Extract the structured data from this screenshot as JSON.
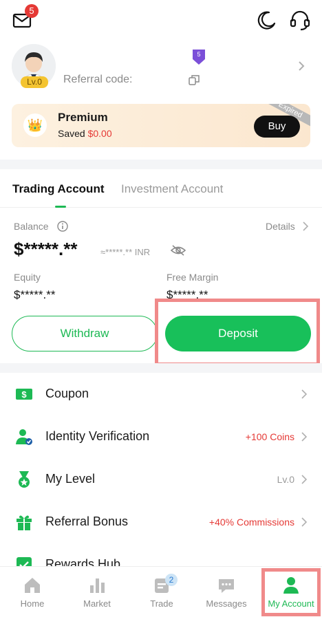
{
  "header": {
    "mail_badge_count": "5",
    "mail_icon": "mail-icon",
    "theme_icon": "moon-icon",
    "support_icon": "headset-icon"
  },
  "profile": {
    "level_badge": "Lv.0",
    "vip_badge_number": "5",
    "referral_label": "Referral code:"
  },
  "premium": {
    "title": "Premium",
    "saved_prefix": "Saved ",
    "saved_amount": "$0.00",
    "buy_label": "Buy",
    "ribbon": "Expired"
  },
  "account_tabs": {
    "active": "Trading Account",
    "inactive": "Investment Account"
  },
  "balance": {
    "label": "Balance",
    "details": "Details",
    "value": "$*****.**",
    "inr_value": "≈*****.** INR",
    "equity_label": "Equity",
    "equity_value": "$*****.**",
    "free_margin_label": "Free Margin",
    "free_margin_value": "$*****.**"
  },
  "actions": {
    "withdraw": "Withdraw",
    "deposit": "Deposit"
  },
  "menu": {
    "items": [
      {
        "label": "Coupon",
        "extra": ""
      },
      {
        "label": "Identity Verification",
        "extra": "+100 Coins"
      },
      {
        "label": "My Level",
        "extra": "Lv.0"
      },
      {
        "label": "Referral Bonus",
        "extra": "+40% Commissions"
      },
      {
        "label": "Rewards Hub",
        "extra": ""
      }
    ]
  },
  "bottom_nav": {
    "items": [
      {
        "label": "Home"
      },
      {
        "label": "Market"
      },
      {
        "label": "Trade",
        "badge": "2"
      },
      {
        "label": "Messages"
      },
      {
        "label": "My Account"
      }
    ]
  },
  "colors": {
    "accent_green": "#1db954",
    "alert_red": "#e53935",
    "highlight_box": "#f08a8a"
  }
}
